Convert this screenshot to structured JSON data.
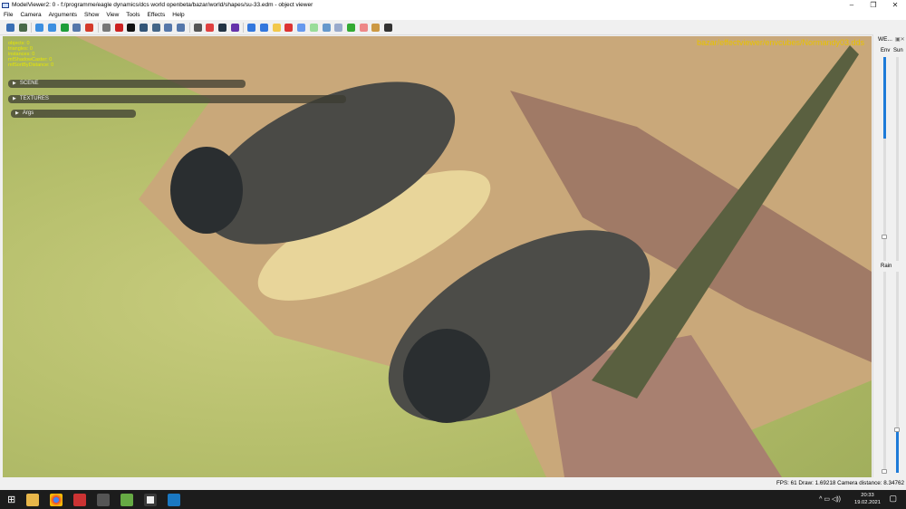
{
  "window": {
    "title": "ModelViewer2: 0 - f:/programme/eagle dynamics/dcs world openbeta/bazar/world/shapes/su-33.edm - object viewer",
    "minimize": "–",
    "maximize": "❐",
    "close": "✕"
  },
  "menu": [
    "File",
    "Camera",
    "Arguments",
    "Show",
    "View",
    "Tools",
    "Effects",
    "Help"
  ],
  "toolbar": {
    "icons": [
      {
        "name": "save-icon",
        "color": "#3a6fb5"
      },
      {
        "name": "user-icon",
        "color": "#4a6a4a"
      },
      null,
      {
        "name": "sphere-icon",
        "color": "#3d8fe0"
      },
      {
        "name": "rotate-icon",
        "color": "#3d8fe0"
      },
      {
        "name": "refresh-icon",
        "color": "#1e9e3a"
      },
      {
        "name": "image-icon",
        "color": "#5577aa"
      },
      {
        "name": "runner-icon",
        "color": "#d43a2a"
      },
      null,
      {
        "name": "bug-icon",
        "color": "#777"
      },
      {
        "name": "crosshair-icon",
        "color": "#cc2222"
      },
      {
        "name": "black-square-icon",
        "color": "#111"
      },
      {
        "name": "funnel-icon",
        "color": "#335577"
      },
      {
        "name": "cone-icon",
        "color": "#446688"
      },
      {
        "name": "arrow-right-icon",
        "color": "#5577aa"
      },
      {
        "name": "arrow-left-icon",
        "color": "#5577aa"
      },
      null,
      {
        "name": "portrait-icon",
        "color": "#555"
      },
      {
        "name": "rgb-icon",
        "color": "#e04040"
      },
      {
        "name": "monitor-icon",
        "color": "#223344"
      },
      {
        "name": "undo-icon",
        "color": "#6633aa"
      },
      null,
      {
        "name": "bar-chart-icon",
        "color": "#3377dd"
      },
      {
        "name": "dot-icon",
        "color": "#3377dd"
      },
      {
        "name": "folder-icon",
        "color": "#f2c84b"
      },
      {
        "name": "cube-icon",
        "color": "#dd3333"
      },
      {
        "name": "blue-sphere-icon",
        "color": "#6699ee"
      },
      {
        "name": "green-sphere-icon",
        "color": "#99dd99"
      },
      {
        "name": "tree-icon",
        "color": "#6699cc"
      },
      {
        "name": "list-icon",
        "color": "#99aacc"
      },
      {
        "name": "grid-icon",
        "color": "#33aa33"
      },
      {
        "name": "target-icon",
        "color": "#ee8888"
      },
      {
        "name": "person-icon",
        "color": "#cc9944"
      },
      {
        "name": "arrows-icon",
        "color": "#333"
      }
    ]
  },
  "viewport": {
    "stats": [
      "objects: 0",
      "triangles: 0",
      "instances: 0",
      "mfShadowCaster: 0",
      "mfSortByDistance: 0"
    ],
    "panels": [
      {
        "label": "SCENE"
      },
      {
        "label": "TEXTURES"
      },
      {
        "label": "Args"
      }
    ],
    "env_texture": "bazar/effectviewer/envcubes/Normandy03.dds"
  },
  "right_panel": {
    "title": "WE...",
    "env_label": "Env",
    "sun_label": "Sun",
    "rain_label": "Rain",
    "env_value": 0.6,
    "sun_value": 0,
    "rain_value": 0.2
  },
  "status": "FPS: 61  Draw: 1.69218  Camera distance: 8.34762",
  "taskbar": {
    "time": "20:33",
    "date": "19.02.2021",
    "tray": "^ ▭ ◁))"
  }
}
